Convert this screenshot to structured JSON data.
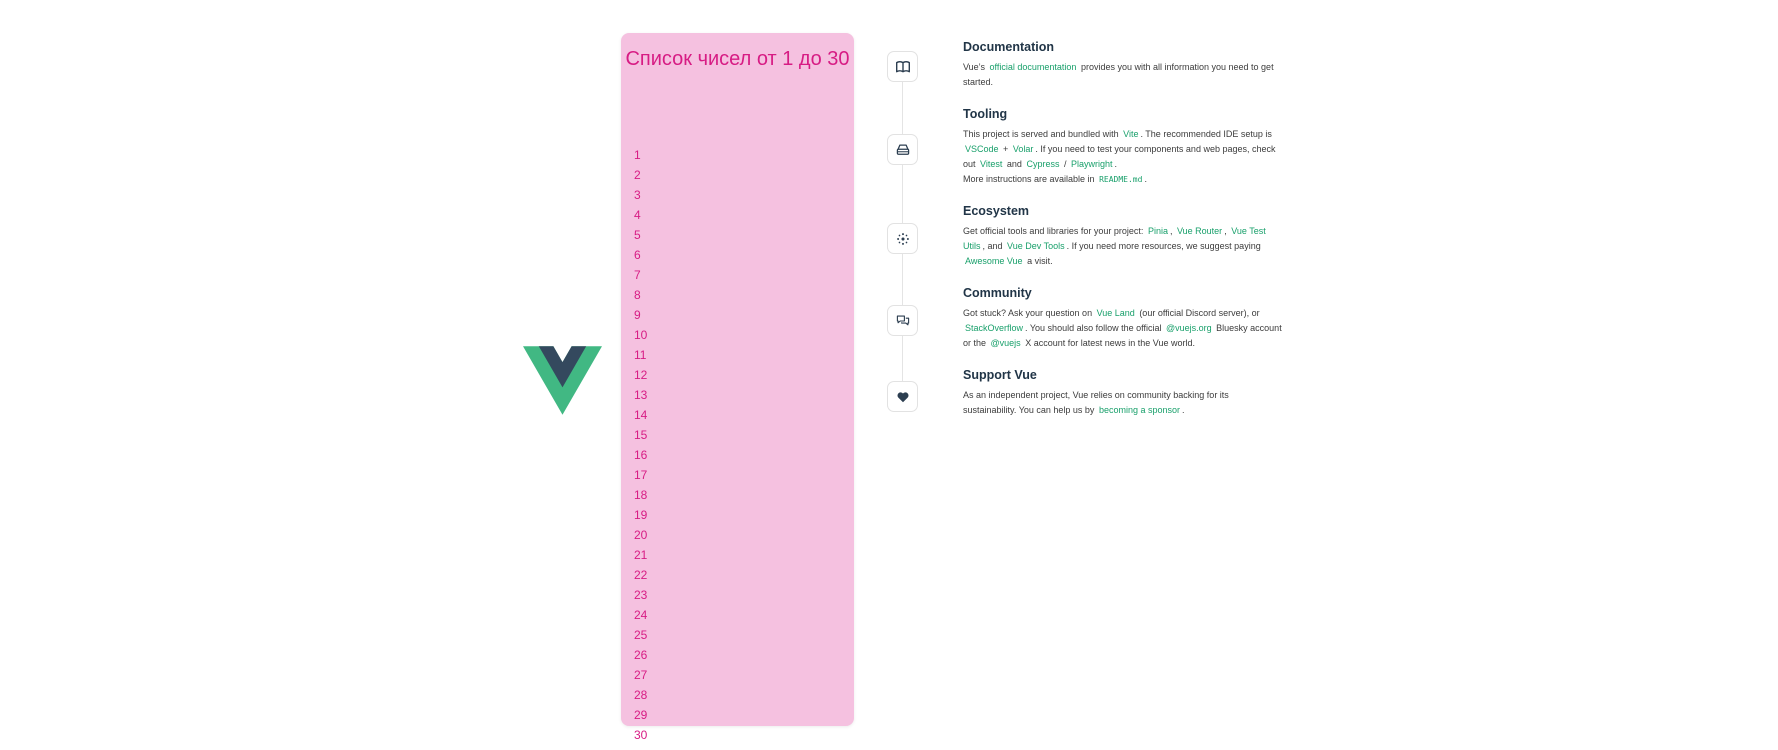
{
  "logo": {
    "name": "Vue logo",
    "colors": {
      "outer": "#41b883",
      "inner": "#34495e"
    }
  },
  "number_card": {
    "title": "Список чисел от 1 до 30",
    "numbers": [
      "1",
      "2",
      "3",
      "4",
      "5",
      "6",
      "7",
      "8",
      "9",
      "10",
      "11",
      "12",
      "13",
      "14",
      "15",
      "16",
      "17",
      "18",
      "19",
      "20",
      "21",
      "22",
      "23",
      "24",
      "25",
      "26",
      "27",
      "28",
      "29",
      "30"
    ]
  },
  "icons": [
    "book-icon",
    "tooling-icon",
    "ecosystem-icon",
    "community-icon",
    "heart-icon"
  ],
  "documentation": {
    "title": "Documentation",
    "t1": "Vue’s",
    "link1": "official documentation",
    "t2": "provides you with all information you need to get started."
  },
  "tooling": {
    "title": "Tooling",
    "t1": "This project is served and bundled with",
    "link_vite": "Vite",
    "t2": ". The recommended IDE setup is",
    "link_vscode": "VSCode",
    "t3": "+",
    "link_volar": "Volar",
    "t4": ". If you need to test your components and web pages, check out",
    "link_vitest": "Vitest",
    "t5": "and",
    "link_cypress": "Cypress",
    "t6": "/",
    "link_playwright": "Playwright",
    "t7": ".",
    "t8": "More instructions are available in",
    "code_readme": "README.md",
    "t9": "."
  },
  "ecosystem": {
    "title": "Ecosystem",
    "t1": "Get official tools and libraries for your project:",
    "link_pinia": "Pinia",
    "t2": ",",
    "link_router": "Vue Router",
    "t3": ",",
    "link_test_utils": "Vue Test Utils",
    "t4": ", and",
    "link_devtools": "Vue Dev Tools",
    "t5": ". If you need more resources, we suggest paying",
    "link_awesome": "Awesome Vue",
    "t6": "a visit."
  },
  "community": {
    "title": "Community",
    "t1": "Got stuck? Ask your question on",
    "link_vueland": "Vue Land",
    "t2": "(our official Discord server), or",
    "link_stackoverflow": "StackOverflow",
    "t3": ". You should also follow the official",
    "link_vuejs_org": "@vuejs.org",
    "t4": "Bluesky account or the",
    "link_vuejs": "@vuejs",
    "t5": "X account for latest news in the Vue world."
  },
  "support": {
    "title": "Support Vue",
    "t1": "As an independent project, Vue relies on community backing for its sustainability. You can help us by",
    "link_sponsor": "becoming a sponsor",
    "t2": "."
  },
  "colors": {
    "card_bg": "#f5c1e0",
    "card_text": "#d71c84",
    "link": "#19a06b",
    "heading": "#213547"
  }
}
